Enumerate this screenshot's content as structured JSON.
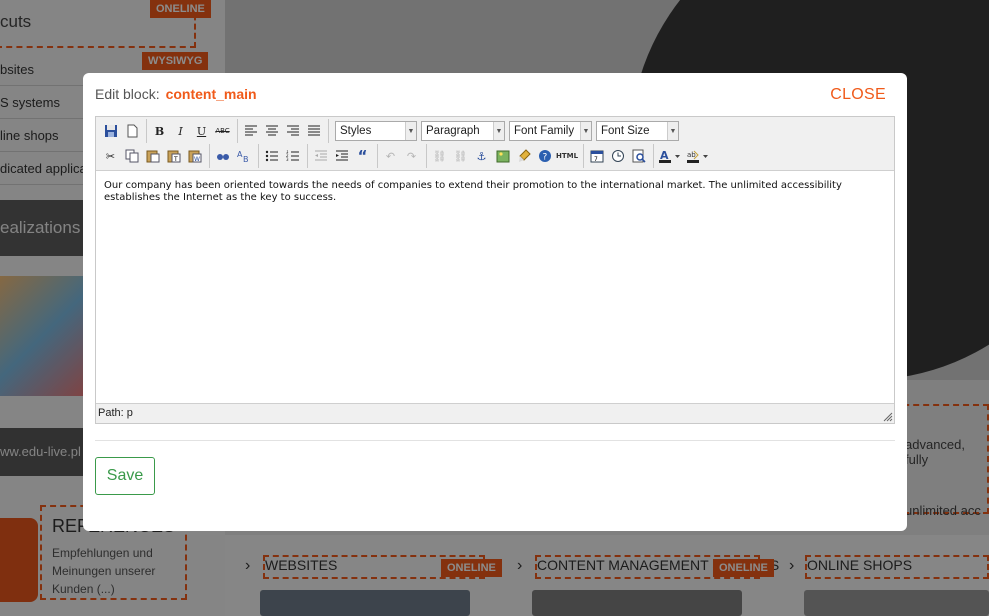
{
  "background": {
    "section_title": "cuts",
    "badge_online": "ONELINE",
    "badge_wysiwyg": "WYSIWYG",
    "menu_items": [
      "bsites",
      "S systems",
      "line shops",
      "dicated applica"
    ],
    "realizations_label": "ealizations",
    "edu_label": "ww.edu-live.pl",
    "references_title": "REFERENCES",
    "references_text": "Empfehlungen und Meinungen unserer Kunden (...)",
    "right_text_1": "advanced, fully",
    "right_text_2": "unlimited acc",
    "columns": [
      {
        "title": "WEBSITES",
        "badge": "ONELINE"
      },
      {
        "title": "CONTENT MANAGEMENT SYSTEMS",
        "badge": "ONELINE"
      },
      {
        "title": "ONLINE SHOPS",
        "badge": ""
      }
    ],
    "accent_color": "#f05a1a"
  },
  "modal": {
    "title_prefix": "Edit block:",
    "block_name": "content_main",
    "close_label": "CLOSE",
    "save_label": "Save",
    "toolbar": {
      "styles_label": "Styles",
      "format_label": "Paragraph",
      "font_family_label": "Font Family",
      "font_size_label": "Font Size",
      "html_label": "HTML",
      "abc_label": "ABC"
    },
    "content_text": "Our company has been oriented towards the needs of companies to extend their promotion to the international market. The unlimited accessibility establishes the Internet as the key to success.",
    "path_label": "Path: p"
  }
}
